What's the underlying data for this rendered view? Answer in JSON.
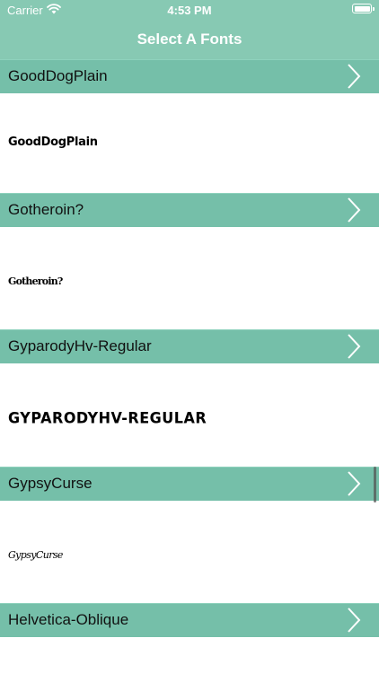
{
  "status_bar": {
    "carrier": "Carrier",
    "time": "4:53 PM",
    "wifi_icon": "wifi-icon",
    "battery_icon": "battery-icon"
  },
  "nav": {
    "title": "Select A Fonts"
  },
  "colors": {
    "header": "#87c9b3",
    "row": "#75bfa9",
    "sample_background": "#ffffff"
  },
  "fonts": [
    {
      "name": "GoodDogPlain",
      "preview": "GoodDogPlain"
    },
    {
      "name": "Gotheroin?",
      "preview": "Gotheroin?"
    },
    {
      "name": "GyparodyHv-Regular",
      "preview": "GYPARODYHV-REGULAR"
    },
    {
      "name": "GypsyCurse",
      "preview": "GypsyCurse"
    },
    {
      "name": "Helvetica-Oblique",
      "preview": ""
    }
  ]
}
